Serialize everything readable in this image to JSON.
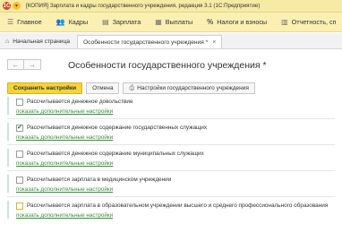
{
  "window": {
    "title": "[КОПИЯ] Зарплата и кадры государственного учреждения, редакция 3.1 (1С:Предприятие)"
  },
  "sections": [
    {
      "label": "Главное",
      "icon": "menu-icon"
    },
    {
      "label": "Кадры",
      "icon": "people-icon"
    },
    {
      "label": "Зарплата",
      "icon": "document-icon"
    },
    {
      "label": "Выплаты",
      "icon": "payments-icon"
    },
    {
      "label": "Налоги и взносы",
      "icon": "percent-icon"
    },
    {
      "label": "Отчетность, сп",
      "icon": "report-icon"
    }
  ],
  "tabs": {
    "home": "Начальная страница",
    "active": "Особенности государственного учреждения *"
  },
  "form": {
    "title": "Особенности государственного учреждения *"
  },
  "toolbar": {
    "save": "Сохранить настройки",
    "cancel": "Отмена",
    "institution_settings": "Настройки государственного учреждения"
  },
  "settings": [
    {
      "label": "Рассчитывается денежное довольствие",
      "checked": false,
      "more": "показать дополнительные настройки"
    },
    {
      "label": "Рассчитывается денежное содержание государственных служащих",
      "checked": true,
      "more": "показать дополнительные настройки"
    },
    {
      "label": "Рассчитывается денежное содержание муниципальных служащих",
      "checked": false,
      "more": "показать дополнительные настройки"
    },
    {
      "label": "Рассчитывается зарплата в медицинском учреждении",
      "checked": false,
      "more": "показать дополнительные настройки"
    },
    {
      "label": "Рассчитывается зарплата в образовательном учреждении высшего и среднего профессионального образования",
      "checked": false,
      "more": "показать дополнительные настройки"
    }
  ],
  "colors": {
    "title_bar": "#f7eaa5",
    "section_bar": "#fbefb2",
    "primary_button": "#f5d43b",
    "link": "#3a8c3a"
  }
}
